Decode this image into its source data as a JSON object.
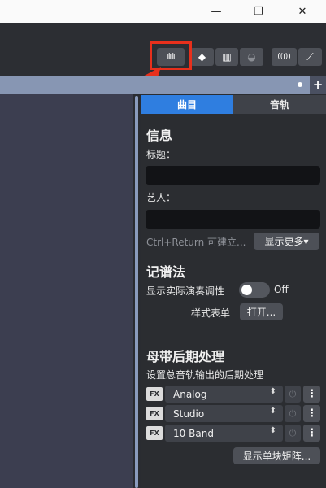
{
  "titlebar": {
    "minimize": "—",
    "restore": "❐",
    "close": "✕"
  },
  "toolbar": {
    "buttons": [
      {
        "name": "waveform-icon",
        "glyph": "ılıılı"
      },
      {
        "name": "guitar-body-icon",
        "glyph": "◆"
      },
      {
        "name": "piano-keys-icon",
        "glyph": "▥"
      },
      {
        "name": "drum-icon",
        "glyph": "◒"
      },
      {
        "name": "broadcast-icon",
        "glyph": "((ı))"
      },
      {
        "name": "guitar-icon",
        "glyph": "⟋"
      }
    ]
  },
  "ruler": {
    "add": "+"
  },
  "tabs": [
    "曲目",
    "音轨"
  ],
  "info": {
    "heading": "信息",
    "title_label": "标题：",
    "artist_label": "艺人：",
    "hint": "Ctrl+Return 可建立...",
    "show_more": "显示更多▾"
  },
  "notation": {
    "heading": "记谱法",
    "concert_pitch_label": "显示实际演奏调性",
    "toggle_state": "Off",
    "stylesheet_label": "样式表单",
    "open_button": "打开..."
  },
  "mastering": {
    "heading": "母带后期处理",
    "description": "设置总音轨输出的后期处理",
    "chain": [
      {
        "icon_label": "FX",
        "name": "Analog"
      },
      {
        "icon_label": "FX",
        "name": "Studio"
      },
      {
        "icon_label": "FX",
        "name": "10-Band"
      }
    ],
    "matrix_button": "显示单块矩阵..."
  },
  "colors": {
    "accent": "#2f7ee0",
    "highlight": "#e8301c",
    "ruler": "#8796b3"
  }
}
